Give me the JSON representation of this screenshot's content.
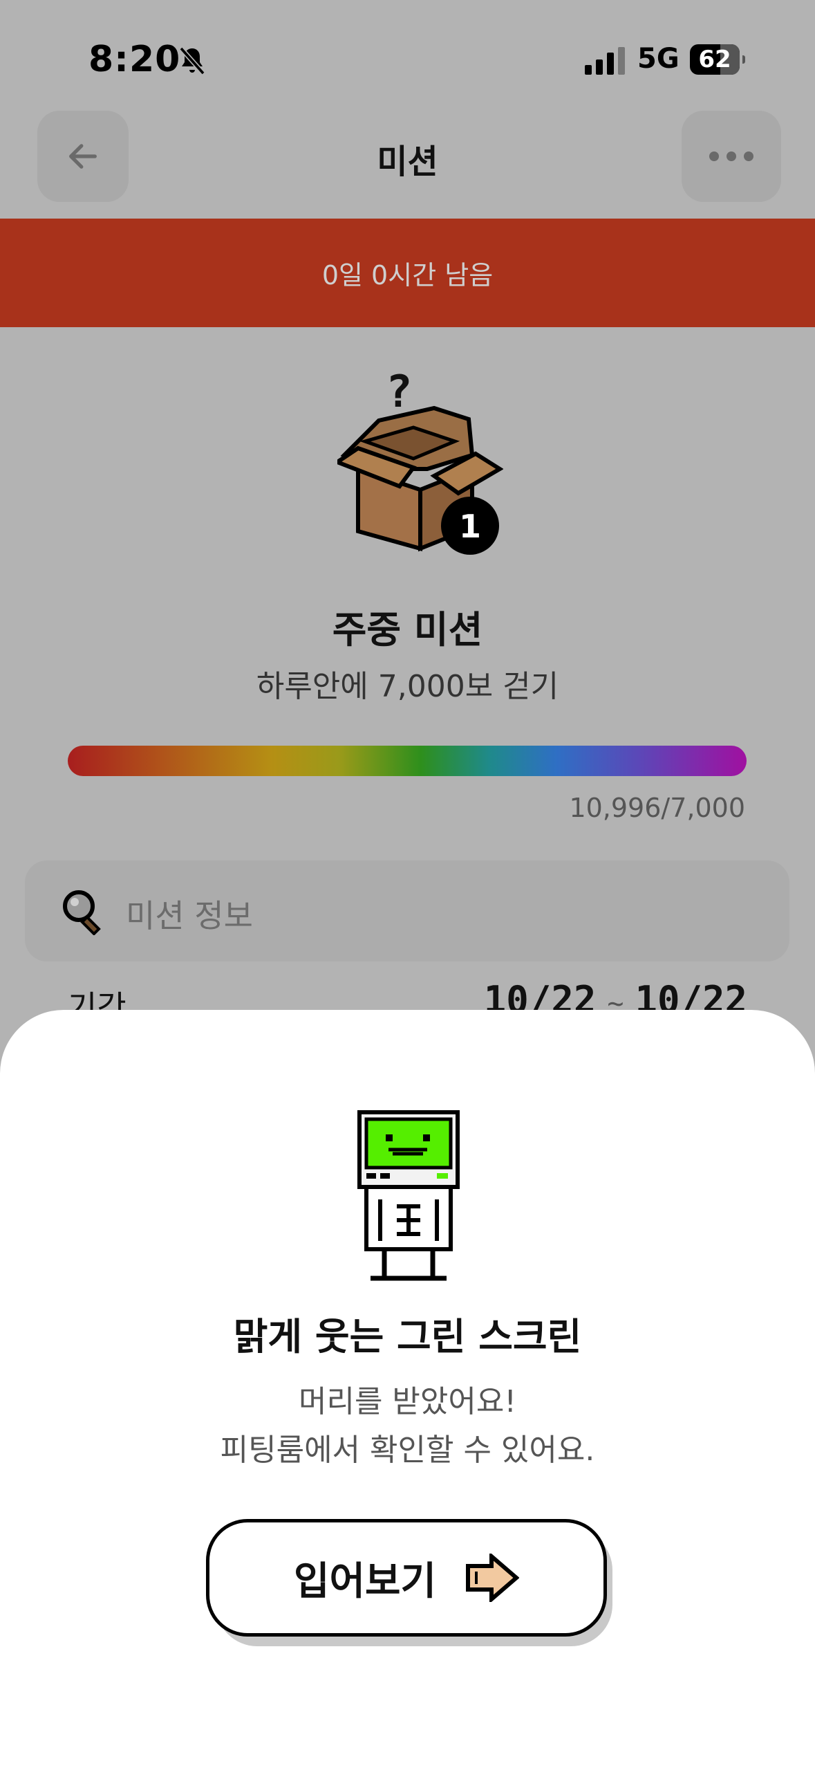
{
  "status_bar": {
    "time": "8:20",
    "network": "5G",
    "battery": "62"
  },
  "nav": {
    "title": "미션"
  },
  "banner": {
    "remaining": "0일 0시간 남음"
  },
  "mission": {
    "badge_count": "1",
    "question_mark": "?",
    "title": "주중 미션",
    "description": "하루안에 7,000보 걷기",
    "progress_text": "10,996/7,000",
    "progress_fraction": 1.0
  },
  "info": {
    "label": "미션 정보"
  },
  "period": {
    "label": "기간",
    "start": "10/22",
    "separator": "~",
    "end": "10/22"
  },
  "sheet": {
    "title": "맑게 웃는 그린 스크린",
    "message_line1": "머리를 받았어요!",
    "message_line2": "피팅룸에서 확인할 수 있어요.",
    "button_label": "입어보기"
  },
  "colors": {
    "banner": "#a8321b",
    "overlay": "#b3b3b3",
    "screen_green": "#55ee00"
  }
}
